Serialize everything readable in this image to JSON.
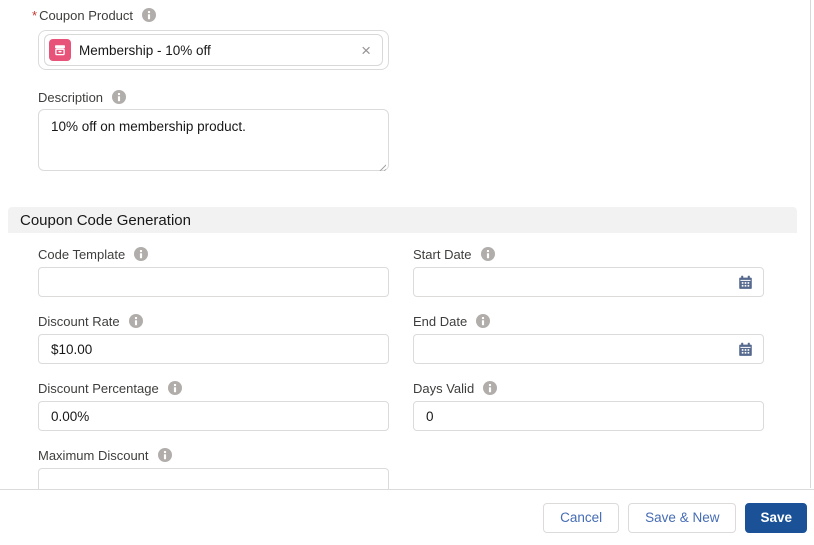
{
  "colors": {
    "brand_button": "#1b5297",
    "neutral_button_text": "#466cb4",
    "product_icon_background": "#e8537a",
    "calendar_icon": "#54698d",
    "info_icon": "#b0adab",
    "input_border": "#dddbda",
    "section_background": "#f3f2f2",
    "label_text": "#3e3e3c",
    "value_text": "#181818",
    "required_asterisk": "#c23934"
  },
  "icons": {
    "info": "info-circle",
    "calendar": "calendar",
    "product": "product-box",
    "remove": "×"
  },
  "coupon_product": {
    "required_marker": "*",
    "label": "Coupon Product",
    "selected_value": "Membership - 10% off"
  },
  "description": {
    "label": "Description",
    "value": "10% off on membership product."
  },
  "section": {
    "title": "Coupon Code Generation"
  },
  "fields": {
    "code_template": {
      "label": "Code Template",
      "value": ""
    },
    "start_date": {
      "label": "Start Date",
      "value": ""
    },
    "discount_rate": {
      "label": "Discount Rate",
      "value": "$10.00"
    },
    "end_date": {
      "label": "End Date",
      "value": ""
    },
    "discount_percentage": {
      "label": "Discount Percentage",
      "value": "0.00%"
    },
    "days_valid": {
      "label": "Days Valid",
      "value": "0"
    },
    "maximum_discount": {
      "label": "Maximum Discount",
      "value": ""
    }
  },
  "footer": {
    "cancel_label": "Cancel",
    "save_new_label": "Save & New",
    "save_label": "Save"
  }
}
